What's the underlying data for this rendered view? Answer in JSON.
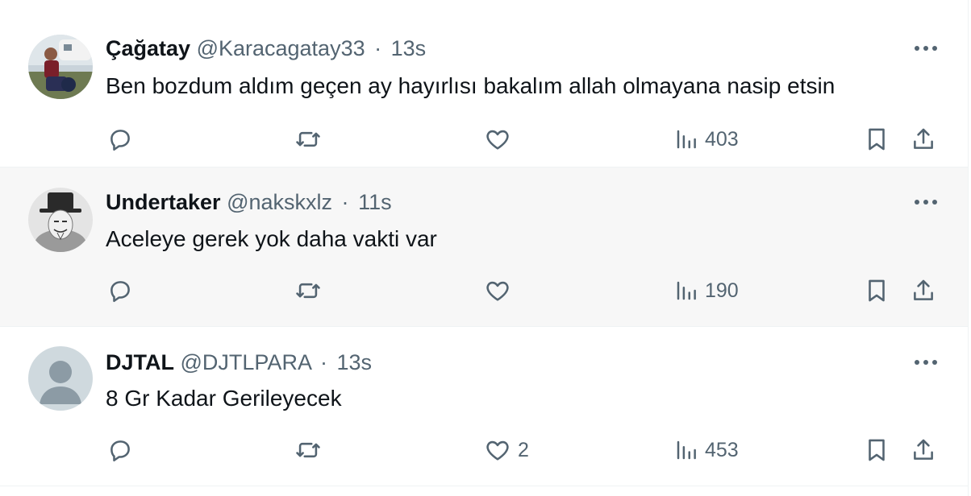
{
  "colors": {
    "text": "#0f1419",
    "secondary": "#536471",
    "border": "#eff3f4",
    "hover_bg": "#f7f7f7"
  },
  "icons": [
    "reply-icon",
    "retweet-icon",
    "like-icon",
    "views-icon",
    "bookmark-icon",
    "share-icon",
    "more-icon"
  ],
  "tweets": [
    {
      "name": "Çağatay",
      "handle": "@Karacagatay33",
      "dot": "·",
      "time": "13s",
      "text": "Ben bozdum aldım geçen ay hayırlısı bakalım allah olmayana nasip etsin",
      "likes": "",
      "views": "403"
    },
    {
      "name": "Undertaker",
      "handle": "@nakskxlz",
      "dot": "·",
      "time": "11s",
      "text": "Aceleye gerek yok daha  vakti var",
      "likes": "",
      "views": "190"
    },
    {
      "name": "DJTAL",
      "handle": "@DJTLPARA",
      "dot": "·",
      "time": "13s",
      "text": "8 Gr Kadar Gerileyecek",
      "likes": "2",
      "views": "453"
    }
  ]
}
